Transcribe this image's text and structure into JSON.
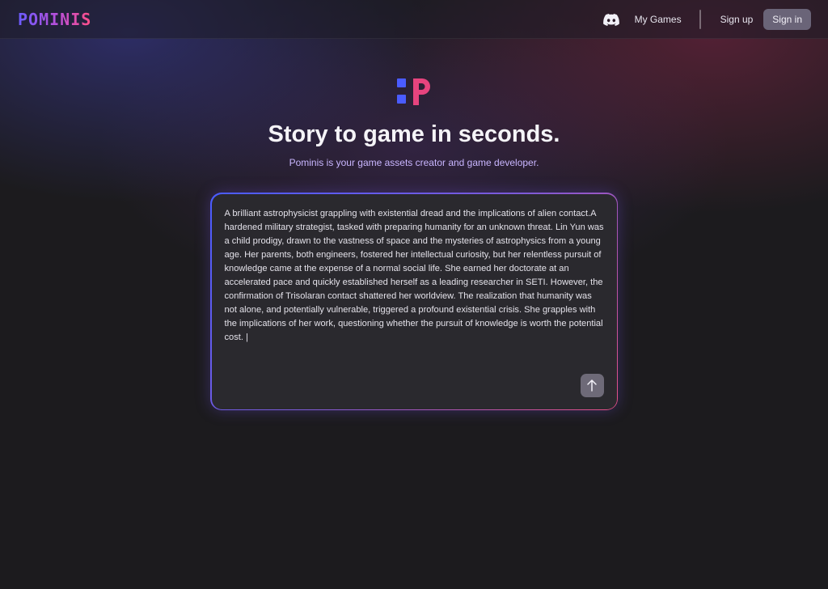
{
  "header": {
    "brand": "POMINIS",
    "nav": {
      "discord_icon": "discord-icon",
      "my_games": "My Games",
      "sign_up": "Sign up",
      "sign_in": "Sign in"
    }
  },
  "hero": {
    "logo_icon": "pominis-logo-icon",
    "title": "Story to game in seconds.",
    "subtitle": "Pominis is your game assets creator and game developer."
  },
  "story_input": {
    "value": "A brilliant astrophysicist grappling with existential dread and the implications of alien contact.A hardened military strategist, tasked with preparing humanity for an unknown threat. Lin Yun was a child prodigy, drawn to the vastness of space and the mysteries of astrophysics from a young age. Her parents, both engineers, fostered her intellectual curiosity, but her relentless pursuit of knowledge came at the expense of a normal social life. She earned her doctorate at an accelerated pace and quickly established herself as a leading researcher in SETI. However, the confirmation of Trisolaran contact shattered her worldview. The realization that humanity was not alone, and potentially vulnerable, triggered a profound existential crisis. She grapples with the implications of her work, questioning whether the pursuit of knowledge is worth the potential cost. ",
    "caret": "|",
    "submit_icon": "arrow-up-icon"
  },
  "colors": {
    "brand_gradient_start": "#6a5cff",
    "brand_gradient_end": "#ff4f86",
    "logo_square": "#4a5cff",
    "logo_p": "#e6447e",
    "subtitle": "#c9b6ff",
    "sign_in_bg": "#6a6478",
    "panel_bg": "#2a292e"
  }
}
